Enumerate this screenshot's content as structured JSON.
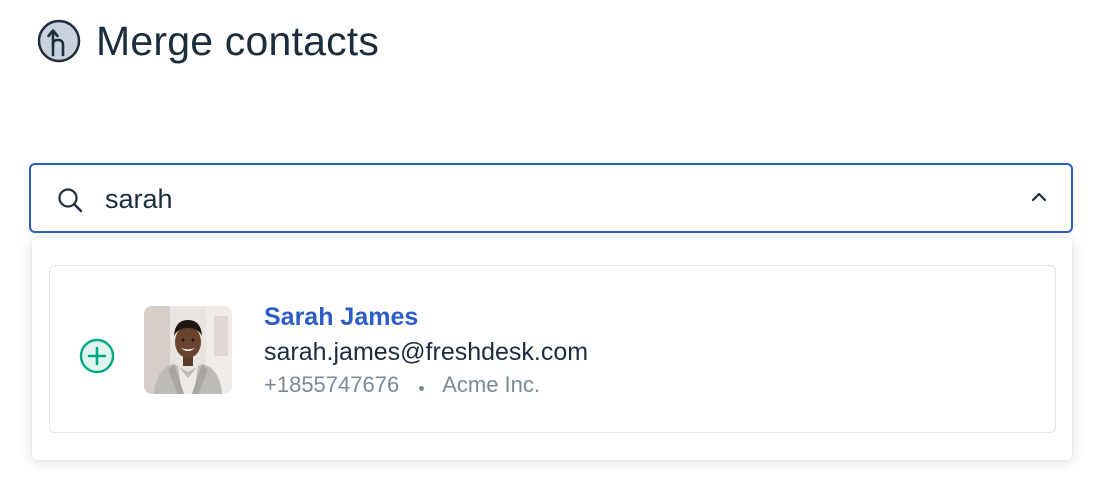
{
  "header": {
    "title": "Merge contacts",
    "icon": "merge-icon"
  },
  "search": {
    "value": "sarah",
    "icon": "search-icon",
    "toggle_icon": "chevron-up-icon"
  },
  "results": [
    {
      "name": "Sarah James",
      "email": "sarah.james@freshdesk.com",
      "phone": "+1855747676",
      "company": "Acme Inc.",
      "action_icon": "add-circle-icon"
    }
  ],
  "colors": {
    "accent": "#2c5cc5",
    "add": "#00a886",
    "text": "#1a2c3e",
    "muted": "#7c8a97",
    "border": "#e2e6ea"
  }
}
